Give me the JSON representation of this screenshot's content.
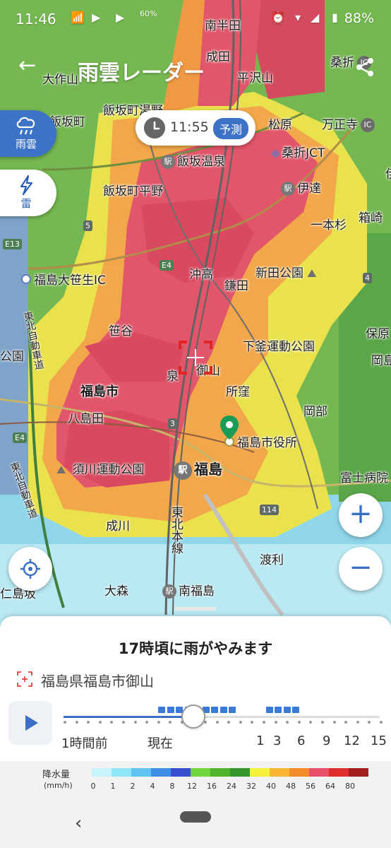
{
  "status_bar": {
    "time": "11:46",
    "battery": "88%",
    "pct_60": "60%"
  },
  "header": {
    "title": "雨雲レーダー",
    "back_icon": "arrow-back-icon",
    "share_icon": "share-icon"
  },
  "layers": {
    "rain_label": "雨雲",
    "thunder_label": "雷"
  },
  "time_chip": {
    "time": "11:55",
    "badge": "予測"
  },
  "map_places": {
    "nanhanda": "南半田",
    "naruta": "成田",
    "daisakuyama": "大作山",
    "kuwaori_top": "桑折",
    "hirasawayama": "平沢山",
    "iizakamachi": "飯坂町",
    "iizakamachi_yuno": "飯坂町湯野",
    "matsubara": "松原",
    "manshoji": "万正寺",
    "iizaka_onsen": "飯坂温泉",
    "kuwaori_jct": "桑折JCT",
    "iizakamachi_hirano": "飯坂町平野",
    "date": "伊達",
    "hakozaki": "箱崎",
    "ippongi": "一本杉",
    "fukushima_osasou_ic": "福島大笹生IC",
    "okitaka": "沖高",
    "nittakoen": "新田公園",
    "kamata": "鎌田",
    "sasaya": "笹谷",
    "shimogama_park": "下釜運動公園",
    "hobara": "保原",
    "izumi": "泉",
    "oyama": "御山",
    "fukushima_city": "福島市",
    "shokubo": "所窪",
    "okabe": "岡部",
    "yashimada": "八島田",
    "city_office": "福島市役所",
    "sukawa_park": "須川運動公園",
    "fukushima_station": "福島",
    "fuji_hospital": "富士病院",
    "narukawa": "成川",
    "tohoku_line": "東北本線",
    "watari": "渡利",
    "omori": "大森",
    "minami_fukushima": "南福島",
    "tohoku_expressway": "東北自動車道",
    "tohoku_expressway_2": "東北自動車道",
    "left_gl": "公園",
    "hukushima_edge": "福",
    "kaiumi": "仁島坂",
    "okajima": "岡島",
    "edge_i": "伊"
  },
  "route_shields": {
    "r13": "E13",
    "r4": "E4",
    "r4b": "E4",
    "r5": "5",
    "r3": "3",
    "r114": "114",
    "r4n": "4"
  },
  "sheet": {
    "message": "17時頃に雨がやみます",
    "location": "福島県福島市御山"
  },
  "timeline": {
    "current_fraction": 0.41,
    "labels": [
      "1時間前",
      "現在",
      "1",
      "3",
      "6",
      "9",
      "12",
      "15"
    ],
    "rain_segments": [
      {
        "from": 0.3,
        "to": 0.56
      },
      {
        "from": 0.64,
        "to": 0.75
      }
    ]
  },
  "legend": {
    "title": "降水量",
    "unit": "(mm/h)",
    "values": [
      "0",
      "1",
      "2",
      "4",
      "8",
      "12",
      "16",
      "24",
      "32",
      "40",
      "48",
      "56",
      "64",
      "80"
    ],
    "colors": [
      "#c8f4fc",
      "#8ee6f7",
      "#60c4f3",
      "#3f8de6",
      "#3a4fd0",
      "#70d43d",
      "#4fb32b",
      "#33962c",
      "#f6f23b",
      "#f8b433",
      "#f38a2b",
      "#e8506a",
      "#e02d2d",
      "#a3211d"
    ]
  }
}
